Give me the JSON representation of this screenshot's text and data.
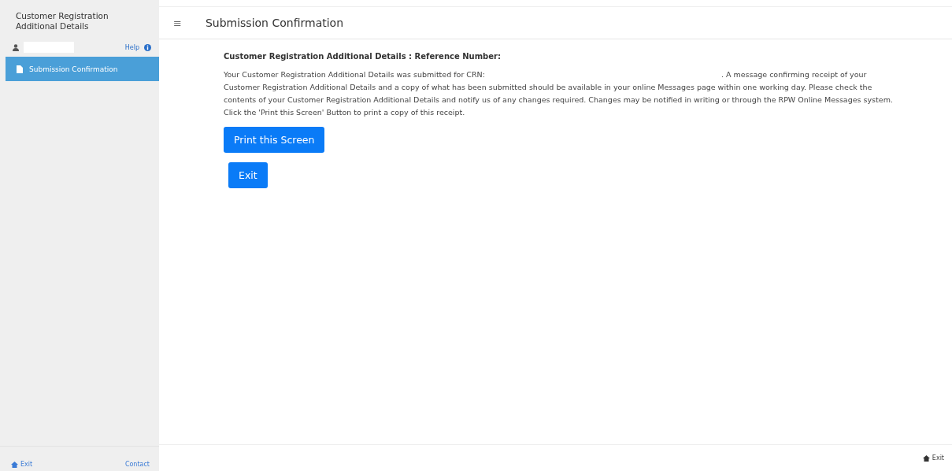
{
  "sidebar": {
    "title": "Customer Registration Additional Details",
    "help_link": "Help",
    "items": [
      {
        "label": "Submission Confirmation",
        "selected": true
      }
    ],
    "footer": {
      "left_link": "Exit",
      "right_link": "Contact"
    }
  },
  "header": {
    "menu_icon": "≡",
    "title": "Submission Confirmation"
  },
  "content": {
    "heading": "Customer Registration Additional Details : Reference Number:",
    "message_before": "Your Customer Registration Additional Details was submitted for CRN:",
    "message_after": ". A message confirming receipt of your Customer Registration Additional Details and a copy of what has been submitted should be available in your online Messages page within one working day. Please check the contents of your Customer Registration Additional Details and notify us of any changes required. Changes may be notified in writing or through the RPW Online Messages system. Click the 'Print this Screen' Button to print a copy of this receipt.",
    "buttons": [
      "Print this Screen",
      "Exit"
    ]
  },
  "footer": {
    "exit_link": "Exit"
  }
}
